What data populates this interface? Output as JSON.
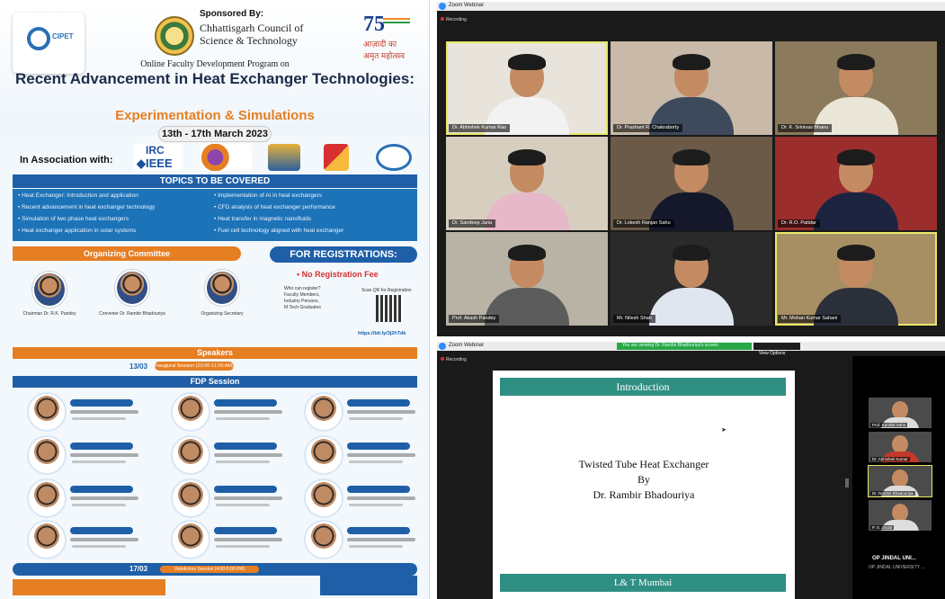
{
  "poster": {
    "sponsored_by": "Sponsored By:",
    "sponsor_name": "Chhattisgarh Council of Science & Technology",
    "azadi_hi": "आज़ादी का अमृत महोत्सव",
    "seventy_five": "75",
    "logo_text": "CIPET",
    "fdp_line": "Online Faculty Development Program on",
    "title": "Recent Advancement in Heat Exchanger Technologies:",
    "subtitle": "Experimentation & Simulations",
    "dates": "13th - 17th March 2023",
    "association_label": "In Association with:",
    "irc_top": "IRC",
    "irc_bottom": "◆IEEE",
    "topics_header": "TOPICS TO BE COVERED",
    "topics_left": [
      "• Heat Exchanger: Introduction and application",
      "• Recent advancement in heat exchanger technology",
      "• Simulation of two phase heat exchangers",
      "• Heat exchanger application in solar systems"
    ],
    "topics_right": [
      "• Implementation of AI in heat exchangers",
      "• CFD analysis of heat exchanger performance",
      "• Heat transfer in magnetic nanofluids",
      "• Fuel cell technology aligned with heat exchanger"
    ],
    "organizing_committee": "Organizing Committee",
    "registrations": "FOR REGISTRATIONS:",
    "no_fee": "• No Registration Fee",
    "who_can_register": "Who can register? Faculty Members, Industry Persons, M.Tech Graduates",
    "scan_qr": "Scan QR for Registration",
    "reg_link": "https://bit.ly/3j2hTdk",
    "committee": [
      "Chairman Dr. R.K. Pandey",
      "Convener Dr. Rambir Bhadouriya",
      "Organizing Secretary"
    ],
    "speakers_bar": "Speakers",
    "inaugural": "Inaugural Session (10:00-11:00 AM)",
    "date_1": "13/03",
    "fdp_session": "FDP Session",
    "date_2": "17/03",
    "valedictory": "Valedictory Session (4:00-5:00 PM)"
  },
  "zoom_top": {
    "window_title": "Zoom Webinar",
    "recording": "Recording",
    "participants": [
      "Dr. Abhishek Kumar Rao",
      "Dr. Prashant R. Chakraborty",
      "Dr. K. Srinivas Bhanu",
      "Dr. Sandeep Jaria",
      "Dr. Lokesh Ranjan Sahu",
      "Dr. R.O. Patidar",
      "Prof. Akash Pandey",
      "Mr. Nilesh Shah",
      "Mr. Mohan Kumar Sahani"
    ]
  },
  "zoom_bottom": {
    "window_title": "Zoom Webinar",
    "recording": "Recording",
    "banner": "You are viewing Dr. Rambir Bhadouriya's screen",
    "view_options": "View Options",
    "slide_header": "Introduction",
    "slide_line1": "Twisted Tube Heat Exchanger",
    "slide_line2": "By",
    "slide_line3": "Dr. Rambir Bhadouriya",
    "slide_footer": "L& T Mumbai",
    "thumbnails": [
      "Prof. Kantilal Sahu",
      "Dr. Abhishek Kumar",
      "Dr. Rambir Bhadouriya",
      "P. S. Jindal"
    ],
    "org_name": "OP JINDAL UNI...",
    "org_sub": "OP JINDAL UNIVERSITY ..."
  }
}
